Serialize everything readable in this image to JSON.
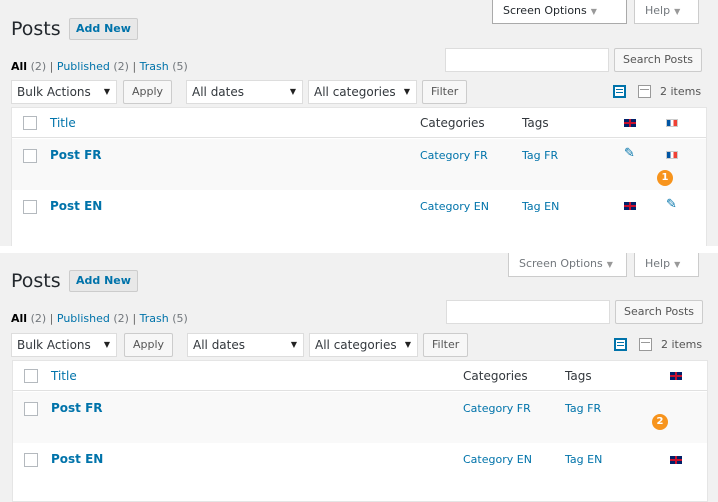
{
  "colors": {
    "link": "#0073aa",
    "badge": "#f7941d",
    "background": "#f1f1f1"
  },
  "panels": [
    {
      "screen_options": "Screen Options",
      "help": "Help",
      "page_title": "Posts",
      "add_new": "Add New",
      "views": {
        "all": "All",
        "all_count": "(2)",
        "published": "Published",
        "published_count": "(2)",
        "trash": "Trash",
        "trash_count": "(5)",
        "sep": "|"
      },
      "search_button": "Search Posts",
      "bulk_actions": "Bulk Actions",
      "apply": "Apply",
      "dates": "All dates",
      "categories": "All categories",
      "filter": "Filter",
      "items": "2 items",
      "columns": {
        "title": "Title",
        "categories": "Categories",
        "tags": "Tags"
      },
      "rows": [
        {
          "title": "Post FR",
          "category": "Category FR",
          "tag": "Tag FR"
        },
        {
          "title": "Post EN",
          "category": "Category EN",
          "tag": "Tag EN"
        }
      ],
      "badge": "1"
    },
    {
      "screen_options": "Screen Options",
      "help": "Help",
      "page_title": "Posts",
      "add_new": "Add New",
      "views": {
        "all": "All",
        "all_count": "(2)",
        "published": "Published",
        "published_count": "(2)",
        "trash": "Trash",
        "trash_count": "(5)",
        "sep": "|"
      },
      "search_button": "Search Posts",
      "bulk_actions": "Bulk Actions",
      "apply": "Apply",
      "dates": "All dates",
      "categories": "All categories",
      "filter": "Filter",
      "items": "2 items",
      "columns": {
        "title": "Title",
        "categories": "Categories",
        "tags": "Tags"
      },
      "rows": [
        {
          "title": "Post FR",
          "category": "Category FR",
          "tag": "Tag FR"
        },
        {
          "title": "Post EN",
          "category": "Category EN",
          "tag": "Tag EN"
        }
      ],
      "badge": "2"
    }
  ]
}
